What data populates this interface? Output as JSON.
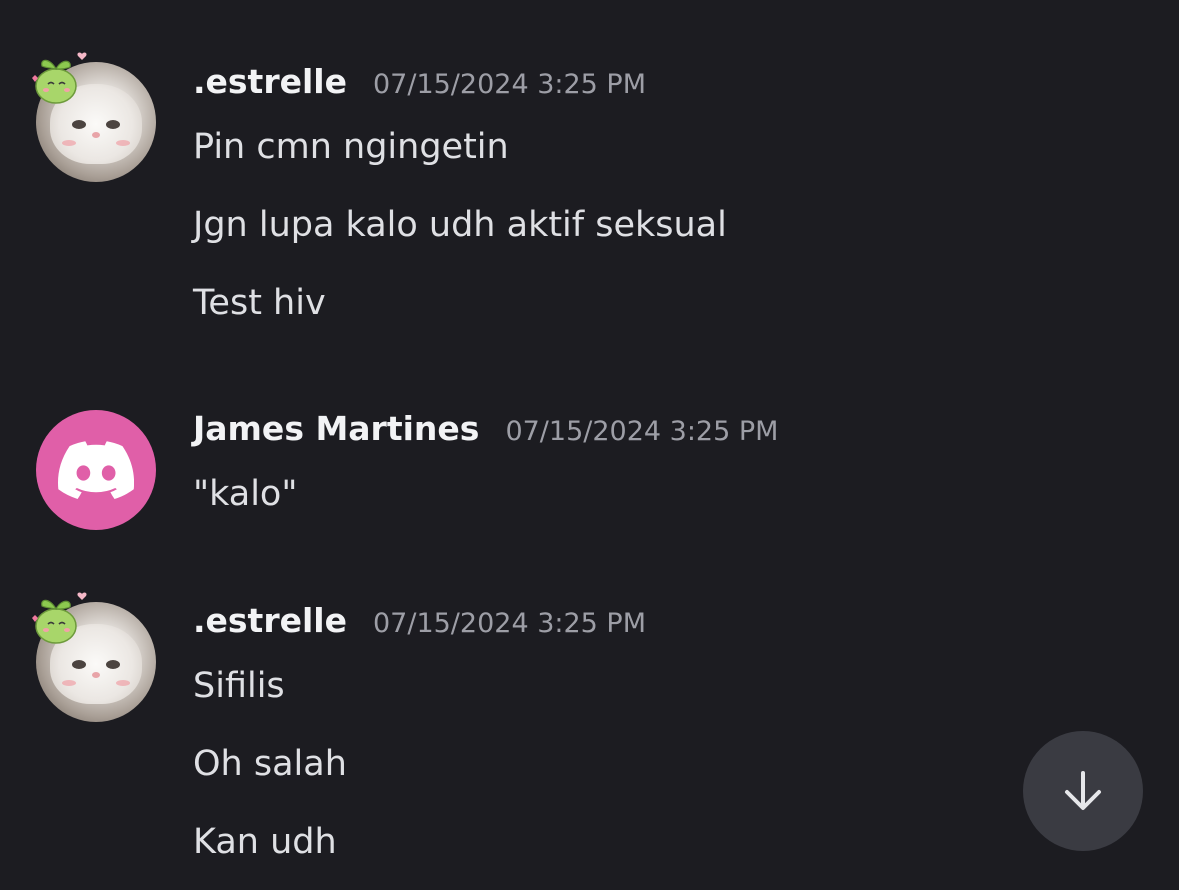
{
  "messages": [
    {
      "author": ".estrelle",
      "timestamp": "07/15/2024 3:25 PM",
      "avatar_icon": "cat-photo-avatar-with-sprout-sticker",
      "lines": [
        "Pin cmn ngingetin",
        "Jgn lupa kalo udh aktif seksual",
        "Test hiv"
      ]
    },
    {
      "author": "James Martines",
      "timestamp": "07/15/2024 3:25 PM",
      "avatar_icon": "discord-logo-icon",
      "avatar_color": "#e05fa8",
      "lines": [
        "\"kalo\""
      ]
    },
    {
      "author": ".estrelle",
      "timestamp": "07/15/2024 3:25 PM",
      "avatar_icon": "cat-photo-avatar-with-sprout-sticker",
      "lines": [
        "Sifilis",
        "Oh salah",
        "Kan udh"
      ]
    }
  ],
  "scroll_button": {
    "icon": "arrow-down-icon"
  },
  "colors": {
    "background": "#1c1c21",
    "username": "#f2f3f5",
    "timestamp": "#9d9ea6",
    "message_text": "#dfe0e4",
    "scroll_button": "#3a3b42"
  }
}
